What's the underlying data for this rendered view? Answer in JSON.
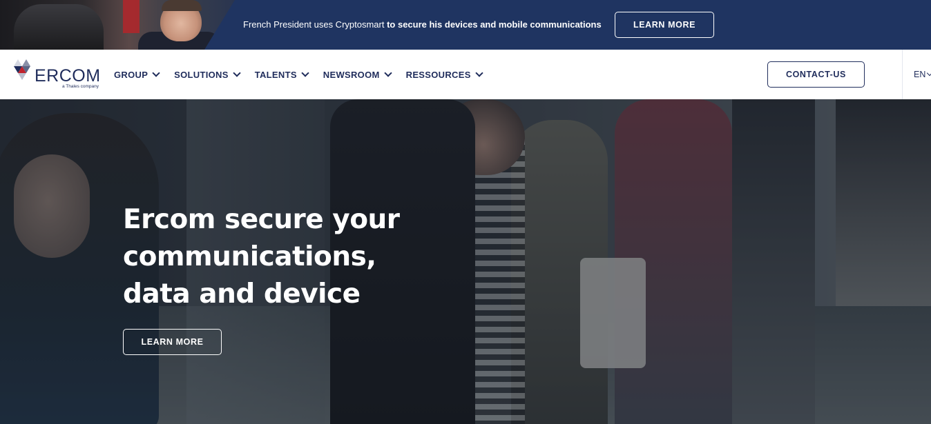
{
  "promo": {
    "text_regular": "French President uses Cryptosmart ",
    "text_bold": "to secure his devices and mobile communications",
    "button_label": "LEARN MORE"
  },
  "header": {
    "logo_text": "ERCOM",
    "logo_subtext": "a Thales company",
    "menu": [
      {
        "label": "GROUP"
      },
      {
        "label": "SOLUTIONS"
      },
      {
        "label": "TALENTS"
      },
      {
        "label": "NEWSROOM"
      },
      {
        "label": "RESSOURCES"
      }
    ],
    "contact_label": "CONTACT-US",
    "language": "EN"
  },
  "hero": {
    "title": "Ercom secure your communications, data and device",
    "button_label": "LEARN MORE"
  },
  "colors": {
    "navy": "#1f2c5b",
    "banner": "#1f3461",
    "accent_red": "#c0232d"
  },
  "icons": [
    "ercom-logo-icon",
    "chevron-down-icon"
  ]
}
